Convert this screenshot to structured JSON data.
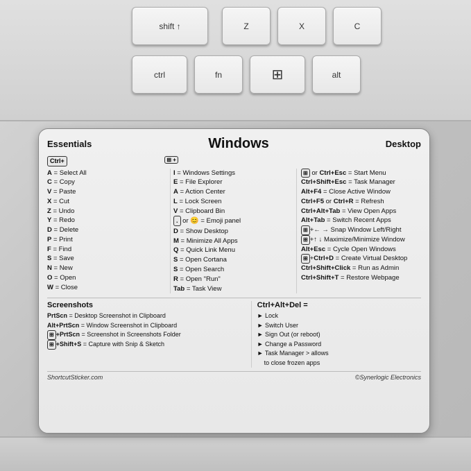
{
  "sticker": {
    "title": "Windows",
    "sections": {
      "essentials_label": "Essentials",
      "desktop_label": "Desktop"
    },
    "ctrl_box": "Ctrl+",
    "win_box": "⊞",
    "essentials": [
      {
        "key": "A",
        "desc": "= Select All"
      },
      {
        "key": "C",
        "desc": "= Copy"
      },
      {
        "key": "V",
        "desc": "= Paste"
      },
      {
        "key": "X",
        "desc": "= Cut"
      },
      {
        "key": "Z",
        "desc": "= Undo"
      },
      {
        "key": "Y",
        "desc": "= Redo"
      },
      {
        "key": "D",
        "desc": "= Delete"
      },
      {
        "key": "P",
        "desc": "= Print"
      },
      {
        "key": "F",
        "desc": "= Find"
      },
      {
        "key": "S",
        "desc": "= Save"
      },
      {
        "key": "N",
        "desc": "= New"
      },
      {
        "key": "O",
        "desc": "= Open"
      },
      {
        "key": "W",
        "desc": "= Close"
      }
    ],
    "win_shortcuts": [
      {
        "key": "I",
        "desc": "= Windows Settings"
      },
      {
        "key": "E",
        "desc": "= File Explorer"
      },
      {
        "key": "A",
        "desc": "= Action Center"
      },
      {
        "key": "L",
        "desc": "= Lock Screen"
      },
      {
        "key": "V",
        "desc": "= Clipboard Bin"
      },
      {
        "key": ".",
        "desc": "or 😊 = Emoji panel"
      },
      {
        "key": "D",
        "desc": "= Show Desktop"
      },
      {
        "key": "M",
        "desc": "= Minimize All Apps"
      },
      {
        "key": "Q",
        "desc": "= Quick Link Menu"
      },
      {
        "key": "S",
        "desc": "= Open Cortana"
      },
      {
        "key": "S",
        "desc": "= Open Search"
      },
      {
        "key": "R",
        "desc": "= Open \"Run\""
      },
      {
        "key": "Tab",
        "desc": "= Task View"
      }
    ],
    "desktop": [
      "⊞ or Ctrl+Esc = Start Menu",
      "Ctrl+Shift+Esc = Task Manager",
      "Alt+F4 = Close Active Window",
      "Ctrl+F5 or Ctrl+R = Refresh",
      "Ctrl+Alt+Tab = View Open Apps",
      "Alt+Tab = Switch Recent Apps",
      "⊞+← → Snap Window Left/Right",
      "⊞+↑ ↓ Maximize/Minimize Window",
      "Alt+Esc = Cycle Open Windows",
      "⊞+Ctrl+D = Create Virtual Desktop",
      "Ctrl+Shift+Click = Run as Admin",
      "Ctrl+Shift+T = Restore Webpage"
    ],
    "ctrl_alt_del": {
      "title": "Ctrl+Alt+Del =",
      "items": [
        "▶ Lock",
        "▶ Switch User",
        "▶ Sign Out (or reboot)",
        "▶ Change a Password",
        "▶ Task Manager > allows to close frozen apps"
      ]
    },
    "screenshots": {
      "title": "Screenshots",
      "items": [
        "PrtScn = Desktop Screenshot in Clipboard",
        "Alt+PrtScn = Window Screenshot in Clipboard",
        "⊞+PrtScn = Screenshot in Screenshots Folder",
        "⊞+Shift+S = Capture with Snip & Sketch"
      ]
    },
    "footer": {
      "left": "ShortcutSticker.com",
      "right": "©Synerlogic Electronics"
    }
  },
  "keys": {
    "shift": "shift ↑",
    "z": "Z",
    "x": "X",
    "c": "C",
    "ctrl": "ctrl",
    "fn": "fn",
    "win": "⊞",
    "alt": "alt"
  }
}
